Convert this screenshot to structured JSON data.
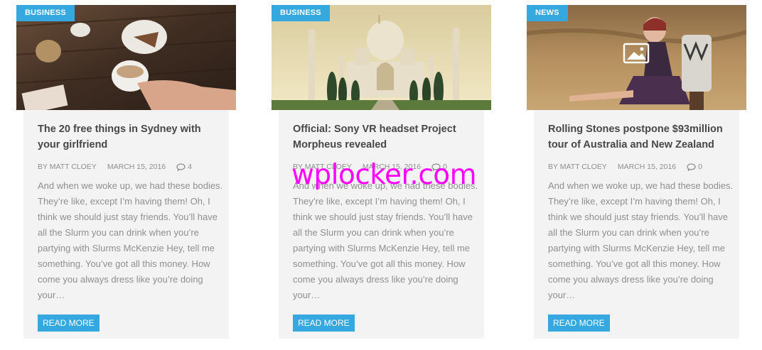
{
  "posts": [
    {
      "category": "BUSINESS",
      "title": "The 20 free things in Sydney with your girlfriend",
      "author": "BY MATT CLOEY",
      "date": "MARCH 15, 2016",
      "comments": "4",
      "excerpt": "And when we woke up, we had these bodies. They’re like, except I’m having them! Oh, I think we should just stay friends. You’ll have all the Slurm you can drink when you’re partying with Slurms McKenzie Hey, tell me something. You’ve got all this money. How come you always dress like you’re doing your…",
      "button": "READ MORE"
    },
    {
      "category": "BUSINESS",
      "title": "Official: Sony VR headset Project Morpheus revealed",
      "author": "BY MATT CLOEY",
      "date": "MARCH 15, 2016",
      "comments": "0",
      "excerpt": "And when we woke up, we had these bodies. They’re like, except I’m having them! Oh, I think we should just stay friends. You’ll have all the Slurm you can drink when you’re partying with Slurms McKenzie Hey, tell me something. You’ve got all this money. How come you always dress like you’re doing your…",
      "button": "READ MORE"
    },
    {
      "category": "NEWS",
      "title": "Rolling Stones postpone $93million tour of Australia and New Zealand",
      "author": "BY MATT CLOEY",
      "date": "MARCH 15, 2016",
      "comments": "0",
      "excerpt": "And when we woke up, we had these bodies. They’re like, except I’m having them! Oh, I think we should just stay friends. You’ll have all the Slurm you can drink when you’re partying with Slurms McKenzie Hey, tell me something. You’ve got all this money. How come you always dress like you’re doing your…",
      "button": "READ MORE"
    }
  ],
  "watermark": "wplocker.com",
  "colors": {
    "accent": "#35a8e0",
    "card_bg": "#f3f3f3",
    "watermark": "#ff00ff"
  }
}
